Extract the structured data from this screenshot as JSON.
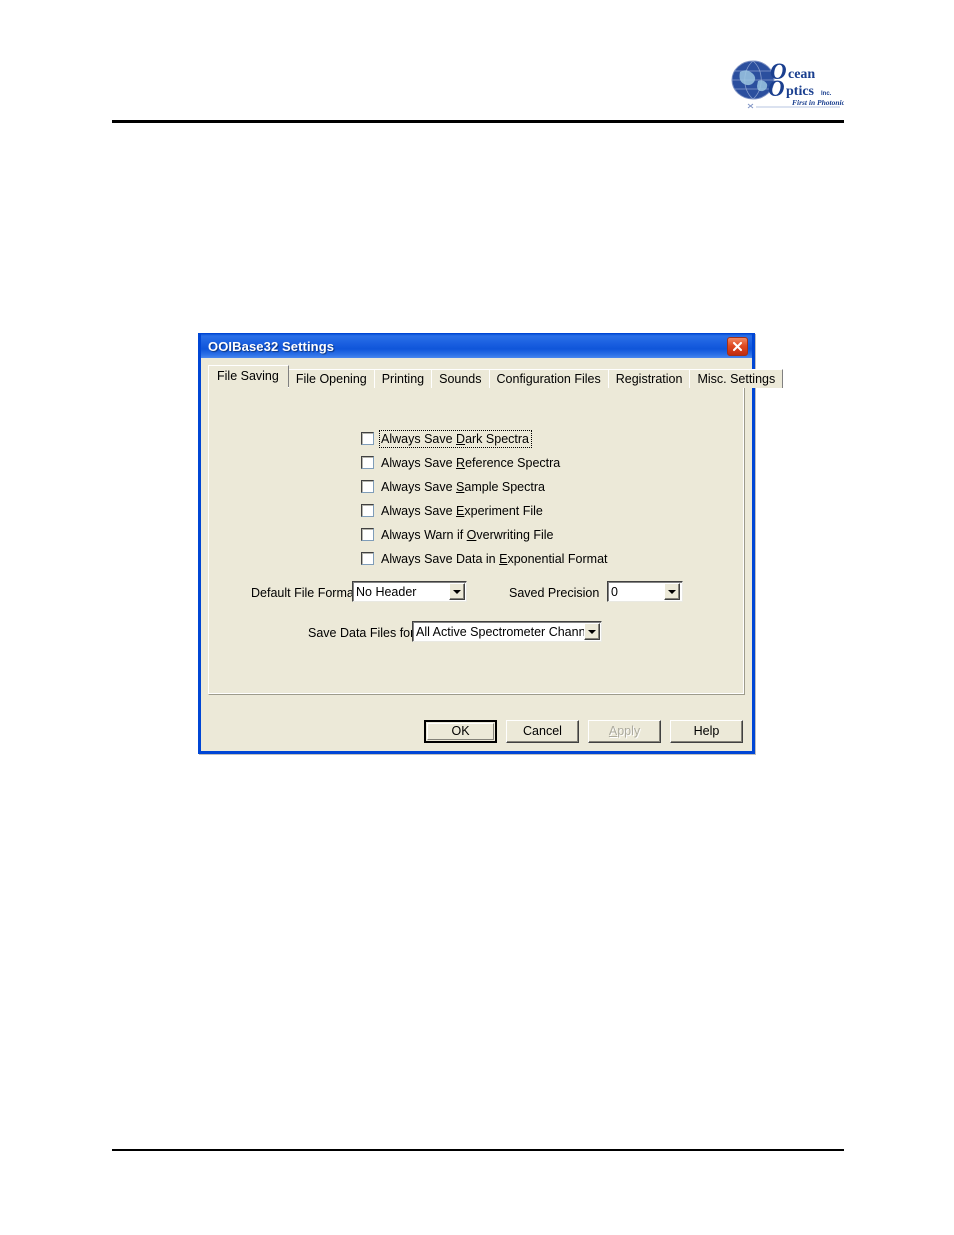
{
  "page": {
    "logo": {
      "brand_line1": "Ocean",
      "brand_line2": "Optics",
      "suffix": "Inc.",
      "tagline": "First in Photonics®",
      "color": "#1a3f8f"
    }
  },
  "dialog": {
    "title": "OOIBase32 Settings",
    "close_icon": "close-icon",
    "titlebar_color": "#1a5fe0",
    "close_button_color": "#d03418",
    "face_color": "#ece9d8",
    "tabs": [
      {
        "label": "File Saving",
        "active": true
      },
      {
        "label": "File Opening",
        "active": false
      },
      {
        "label": "Printing",
        "active": false
      },
      {
        "label": "Sounds",
        "active": false
      },
      {
        "label": "Configuration Files",
        "active": false
      },
      {
        "label": "Registration",
        "active": false
      },
      {
        "label": "Misc. Settings",
        "active": false
      }
    ],
    "checkboxes": [
      {
        "pre": "Always Save ",
        "acc": "D",
        "post": "ark Spectra",
        "checked": false,
        "focused": true
      },
      {
        "pre": "Always Save ",
        "acc": "R",
        "post": "eference Spectra",
        "checked": false,
        "focused": false
      },
      {
        "pre": "Always Save ",
        "acc": "S",
        "post": "ample Spectra",
        "checked": false,
        "focused": false
      },
      {
        "pre": "Always Save ",
        "acc": "E",
        "post": "xperiment File",
        "checked": false,
        "focused": false
      },
      {
        "pre": "Always Warn if ",
        "acc": "O",
        "post": "verwriting File",
        "checked": false,
        "focused": false
      },
      {
        "pre": "Always Save Data in ",
        "acc": "E",
        "post": "xponential Format",
        "checked": false,
        "focused": false
      }
    ],
    "fields": {
      "default_file_format": {
        "label": "Default File Format",
        "value": "No Header"
      },
      "saved_precision": {
        "label": "Saved Precision",
        "value": "0"
      },
      "save_data_files_for": {
        "label": "Save Data Files for",
        "value": "All Active Spectrometer Channels"
      }
    },
    "buttons": {
      "ok": {
        "label": "OK",
        "default": true,
        "disabled": false
      },
      "cancel": {
        "label": "Cancel",
        "default": false,
        "disabled": false
      },
      "apply": {
        "pre": "",
        "acc": "A",
        "post": "pply",
        "default": false,
        "disabled": true
      },
      "help": {
        "label": "Help",
        "default": false,
        "disabled": false
      }
    }
  }
}
